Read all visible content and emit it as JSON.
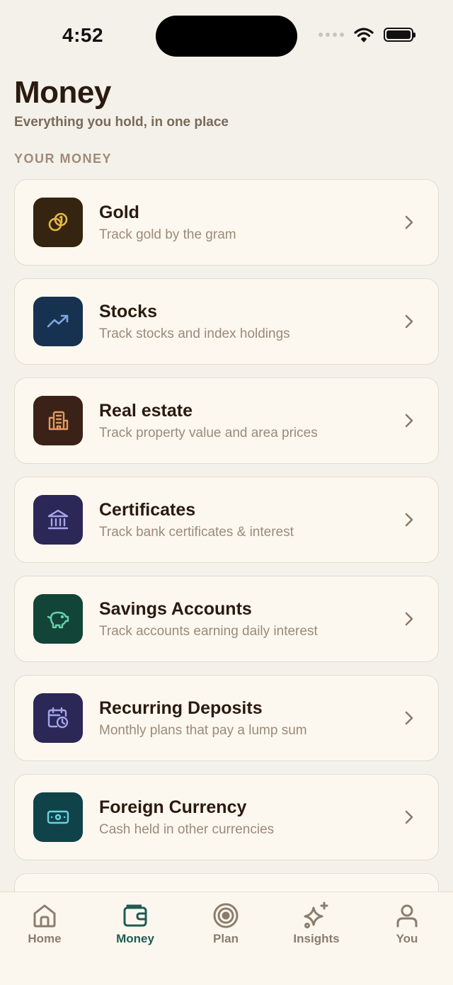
{
  "status_bar": {
    "time": "4:52"
  },
  "header": {
    "title": "Money",
    "subtitle": "Everything you hold, in one place"
  },
  "section_label": "YOUR MONEY",
  "items": [
    {
      "title": "Gold",
      "description": "Track gold by the gram",
      "icon": "gold-coins-icon",
      "bg": "#35240f",
      "fg": "#e2b64a"
    },
    {
      "title": "Stocks",
      "description": "Track stocks and index holdings",
      "icon": "trending-up-icon",
      "bg": "#173150",
      "fg": "#7fa6e0"
    },
    {
      "title": "Real estate",
      "description": "Track property value and area prices",
      "icon": "building-icon",
      "bg": "#3b2218",
      "fg": "#e39a62"
    },
    {
      "title": "Certificates",
      "description": "Track bank certificates & interest",
      "icon": "bank-icon",
      "bg": "#2b2757",
      "fg": "#a7a6ea"
    },
    {
      "title": "Savings Accounts",
      "description": "Track accounts earning daily interest",
      "icon": "piggy-bank-icon",
      "bg": "#124537",
      "fg": "#69d2ad"
    },
    {
      "title": "Recurring Deposits",
      "description": "Monthly plans that pay a lump sum",
      "icon": "calendar-clock-icon",
      "bg": "#2b2756",
      "fg": "#a4a5ea"
    },
    {
      "title": "Foreign Currency",
      "description": "Cash held in other currencies",
      "icon": "banknote-icon",
      "bg": "#10424a",
      "fg": "#6ad3de"
    }
  ],
  "tabs": [
    {
      "label": "Home",
      "icon": "home-icon",
      "active": false
    },
    {
      "label": "Money",
      "icon": "wallet-icon",
      "active": true
    },
    {
      "label": "Plan",
      "icon": "target-icon",
      "active": false
    },
    {
      "label": "Insights",
      "icon": "sparkles-icon",
      "active": false
    },
    {
      "label": "You",
      "icon": "user-icon",
      "active": false
    }
  ],
  "colors": {
    "background": "#f4f1ea",
    "card": "#fdf8ef",
    "accent": "#1f5b53",
    "tab_inactive": "#8c7c6c"
  }
}
